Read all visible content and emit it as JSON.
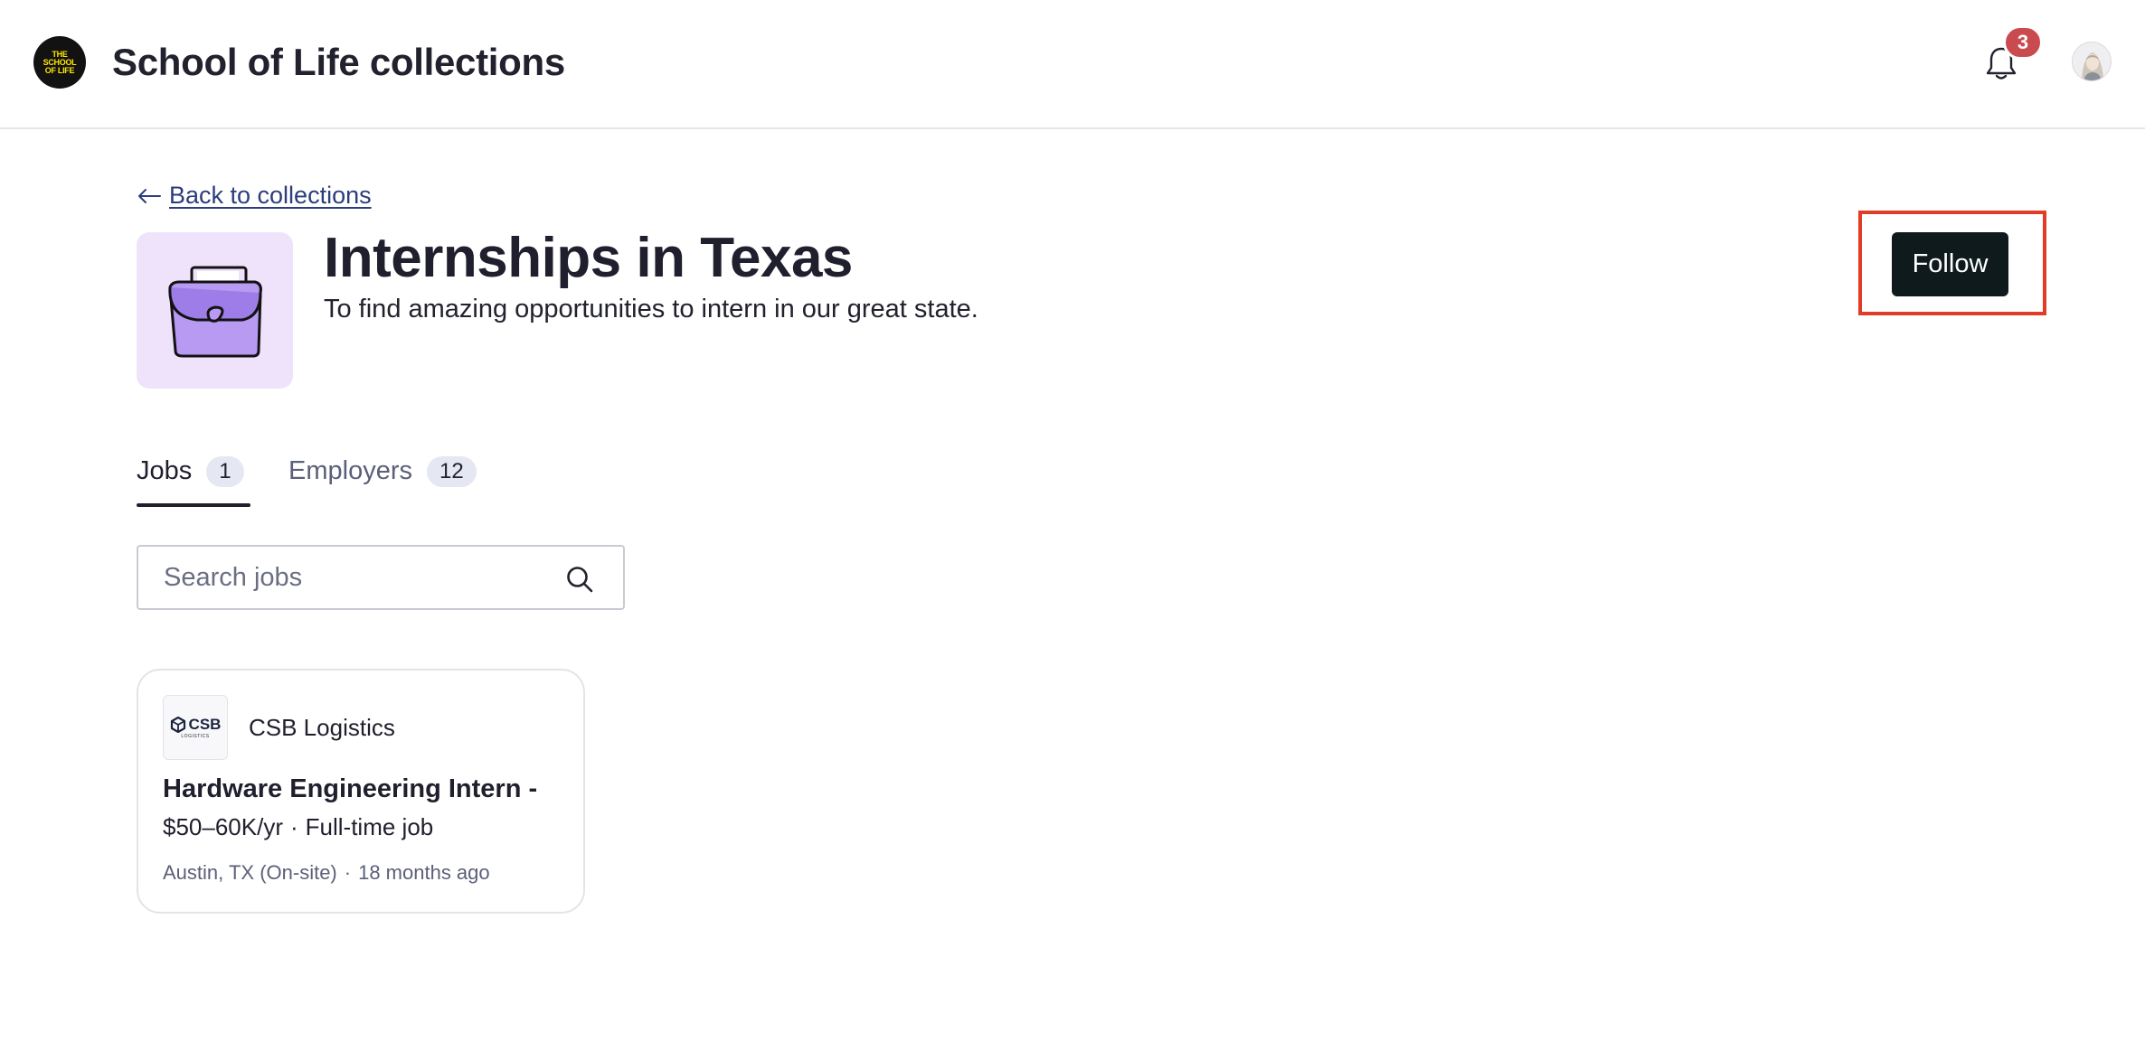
{
  "app": {
    "logo_text": "THE\nSCHOOL\nOF LIFE",
    "title": "School of Life collections",
    "notifications_count": "3"
  },
  "back_link": {
    "label": "Back to collections"
  },
  "collection": {
    "title": "Internships in Texas",
    "description": "To find amazing opportunities to intern in our great state.",
    "icon": "briefcase-icon",
    "follow_label": "Follow"
  },
  "tabs": [
    {
      "label": "Jobs",
      "count": "1",
      "active": true
    },
    {
      "label": "Employers",
      "count": "12",
      "active": false
    }
  ],
  "search": {
    "placeholder": "Search jobs",
    "value": ""
  },
  "jobs": [
    {
      "company": "CSB Logistics",
      "company_logo_text": "CSB",
      "company_logo_subtext": "LOGISTICS",
      "title": "Hardware Engineering Intern -",
      "salary": "$50–60K/yr",
      "separator": "·",
      "type": "Full-time job",
      "location": "Austin, TX (On-site)",
      "posted": "18 months ago"
    }
  ],
  "colors": {
    "accent_dark": "#0e1a1c",
    "badge_red": "#c94a4f",
    "highlight_red": "#e03c26",
    "icon_bg": "#efe3fb",
    "briefcase_purple": "#b89af2"
  }
}
